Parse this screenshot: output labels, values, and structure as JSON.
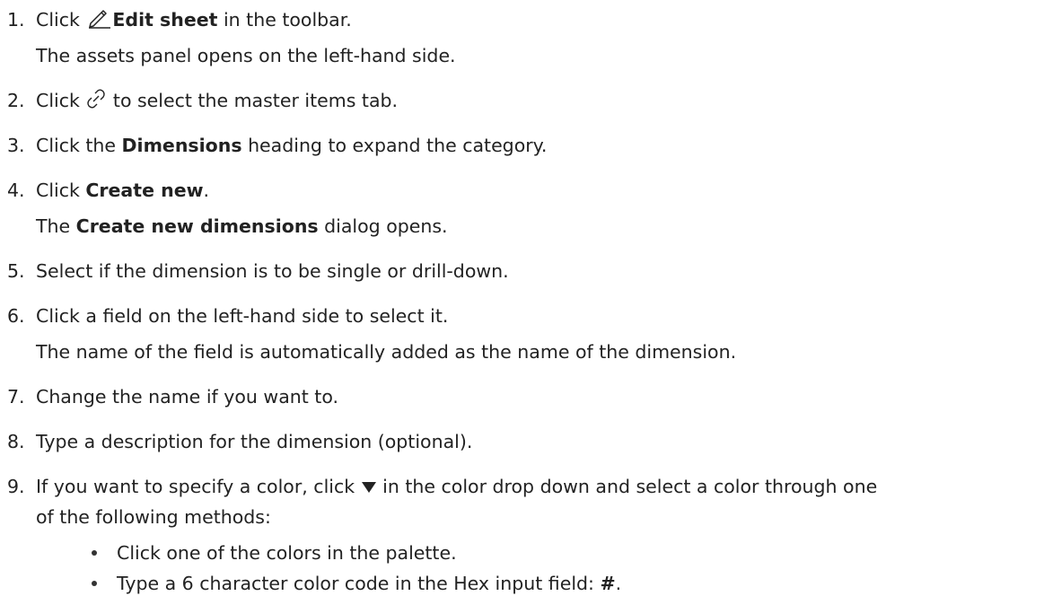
{
  "steps": [
    {
      "num": "1.",
      "pre": "Click",
      "bold": "Edit sheet",
      "post": " in the toolbar.",
      "icon": "edit-pencil-icon",
      "sub": "The assets panel opens on the left-hand side."
    },
    {
      "num": "2.",
      "pre": "Click",
      "post": " to select the master items tab.",
      "icon": "link-icon"
    },
    {
      "num": "3.",
      "pre": "Click the ",
      "bold": "Dimensions",
      "post": " heading to expand the category."
    },
    {
      "num": "4.",
      "pre": "Click ",
      "bold": "Create new",
      "post": ".",
      "sub_pre": "The ",
      "sub_bold": "Create new dimensions",
      "sub_post": " dialog opens."
    },
    {
      "num": "5.",
      "text": "Select if the dimension is to be single or drill-down."
    },
    {
      "num": "6.",
      "text": "Click a field on the left-hand side to select it.",
      "sub": "The name of the field is automatically added as the name of the dimension."
    },
    {
      "num": "7.",
      "text": "Change the name if you want to."
    },
    {
      "num": "8.",
      "text": "Type a description for the dimension (optional)."
    },
    {
      "num": "9.",
      "pre": "If you want to specify a color, click",
      "post": " in the color drop down and select a color through one",
      "icon": "triangle-down-icon",
      "sub": "of the following methods:"
    }
  ],
  "bullets": [
    {
      "text": "Click one of the colors in the palette."
    },
    {
      "pre": "Type a 6 character color code in the Hex input field: ",
      "bold": "#",
      "post": "."
    }
  ]
}
